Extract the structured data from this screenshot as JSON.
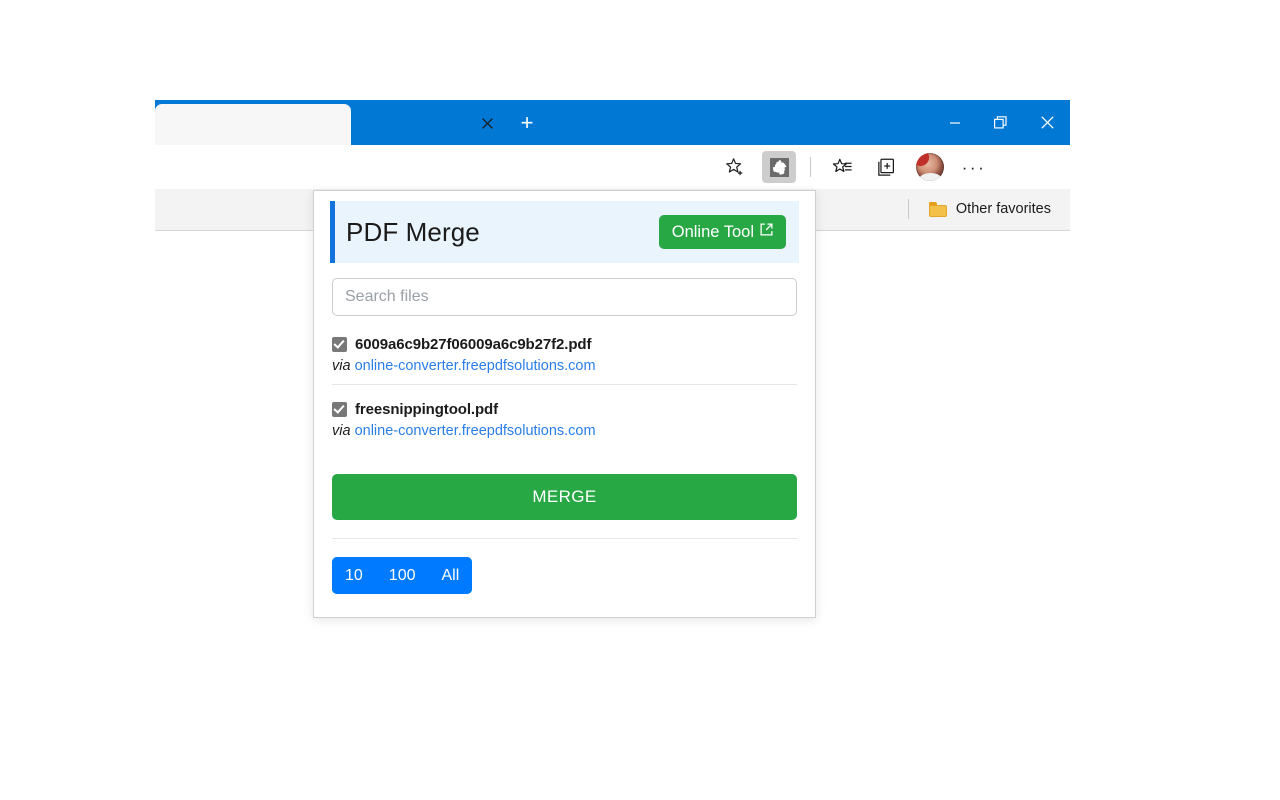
{
  "browser": {
    "tab": {
      "title": "",
      "close_label": "✕",
      "close_icon": "close-icon"
    },
    "new_tab_label": "+",
    "window_controls": {
      "minimize": "minimize-icon",
      "restore": "restore-icon",
      "close": "close-icon"
    },
    "toolbar_icons": [
      {
        "name": "add-favorite-star-icon"
      },
      {
        "name": "extension-puzzle-icon",
        "active": true
      },
      {
        "name": "favorites-list-icon"
      },
      {
        "name": "collections-icon"
      },
      {
        "name": "profile-avatar"
      },
      {
        "name": "settings-more-icon",
        "label": "···"
      }
    ],
    "favorites_bar": {
      "folder_icon": "folder-icon",
      "other_favorites_label": "Other favorites"
    }
  },
  "popup": {
    "title": "PDF Merge",
    "online_tool": {
      "label": "Online Tool",
      "icon": "external-link-icon"
    },
    "search": {
      "value": "",
      "placeholder": "Search files"
    },
    "files": [
      {
        "name": "6009a6c9b27f06009a6c9b27f2.pdf",
        "checked": true,
        "via_word": "via",
        "source": "online-converter.freepdfsolutions.com"
      },
      {
        "name": "freesnippingtool.pdf",
        "checked": true,
        "via_word": "via",
        "source": "online-converter.freepdfsolutions.com"
      }
    ],
    "merge_label": "MERGE",
    "pager": [
      {
        "label": "10"
      },
      {
        "label": "100"
      },
      {
        "label": "All"
      }
    ]
  },
  "colors": {
    "titlebar_blue": "#0078d4",
    "accent_blue": "#1273de",
    "header_band": "#eaf4fd",
    "green": "#28a745",
    "pager_blue": "#007bff",
    "link_blue": "#2b7de9"
  }
}
